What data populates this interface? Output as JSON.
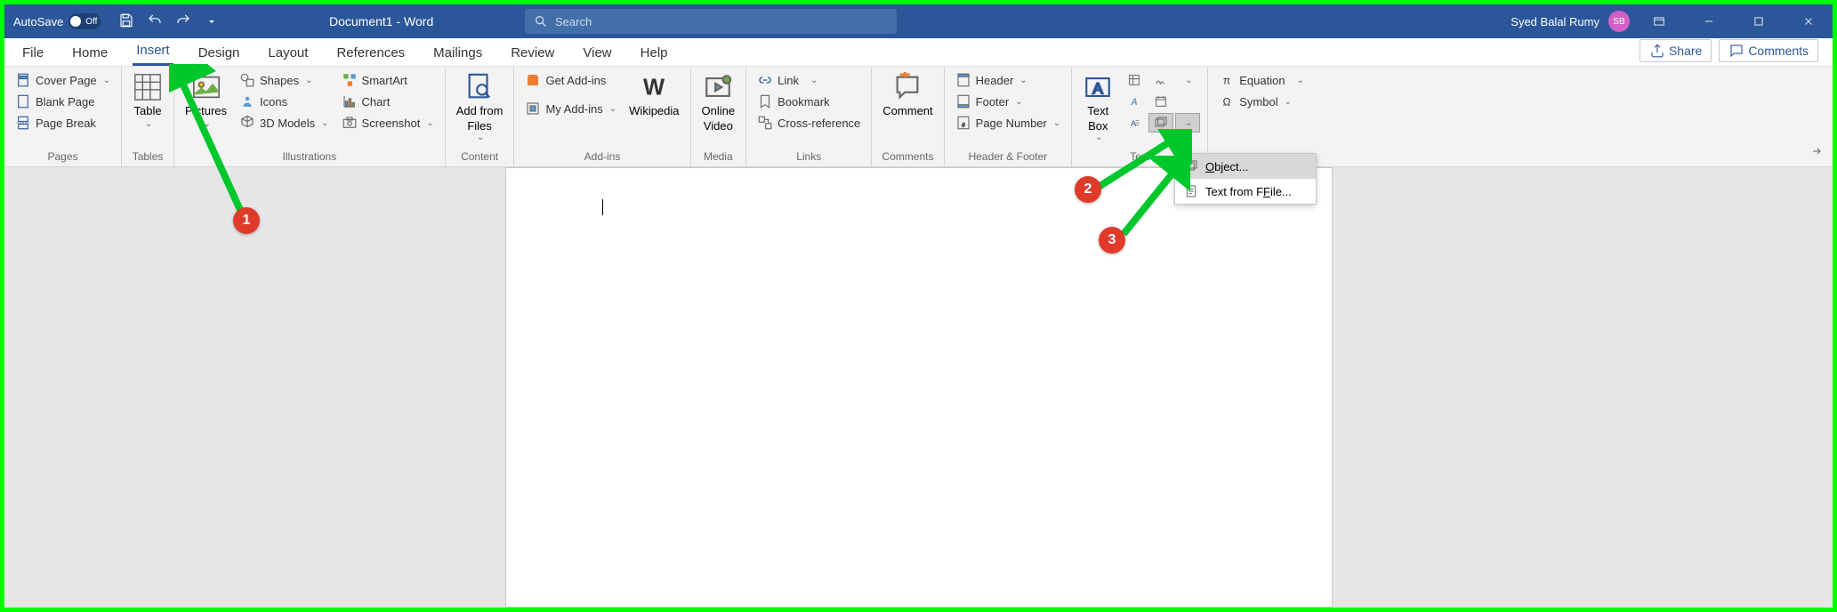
{
  "titlebar": {
    "autosave_label": "AutoSave",
    "autosave_state": "Off",
    "doc_title": "Document1  -  Word",
    "search_placeholder": "Search",
    "username": "Syed Balal Rumy",
    "avatar_initials": "SB"
  },
  "tabs": {
    "items": [
      "File",
      "Home",
      "Insert",
      "Design",
      "Layout",
      "References",
      "Mailings",
      "Review",
      "View",
      "Help"
    ],
    "active_index": 2,
    "share_label": "Share",
    "comments_label": "Comments"
  },
  "ribbon": {
    "pages": {
      "label": "Pages",
      "cover_page": "Cover Page",
      "blank_page": "Blank Page",
      "page_break": "Page Break"
    },
    "tables": {
      "label": "Tables",
      "table": "Table"
    },
    "illustrations": {
      "label": "Illustrations",
      "pictures": "Pictures",
      "shapes": "Shapes",
      "icons": "Icons",
      "models": "3D Models",
      "smartart": "SmartArt",
      "chart": "Chart",
      "screenshot": "Screenshot"
    },
    "content": {
      "label": "Content",
      "addfrom": "Add from",
      "files": "Files"
    },
    "addins": {
      "label": "Add-ins",
      "get": "Get Add-ins",
      "my": "My Add-ins",
      "wikipedia": "Wikipedia"
    },
    "media": {
      "label": "Media",
      "online_video": "Online",
      "video": "Video"
    },
    "links": {
      "label": "Links",
      "link": "Link",
      "bookmark": "Bookmark",
      "cross": "Cross-reference"
    },
    "comments": {
      "label": "Comments",
      "comment": "Comment"
    },
    "headerfooter": {
      "label": "Header & Footer",
      "header": "Header",
      "footer": "Footer",
      "pagenum": "Page Number"
    },
    "text": {
      "label": "Text",
      "textbox": "Text",
      "box": "Box"
    },
    "symbols": {
      "label": "",
      "equation": "Equation",
      "symbol": "Symbol"
    }
  },
  "dropdown": {
    "object": "bject...",
    "object_prefix": "O",
    "textfile": "ile...",
    "textfile_prefix": "Text from F"
  },
  "annotations": {
    "b1": "1",
    "b2": "2",
    "b3": "3"
  }
}
